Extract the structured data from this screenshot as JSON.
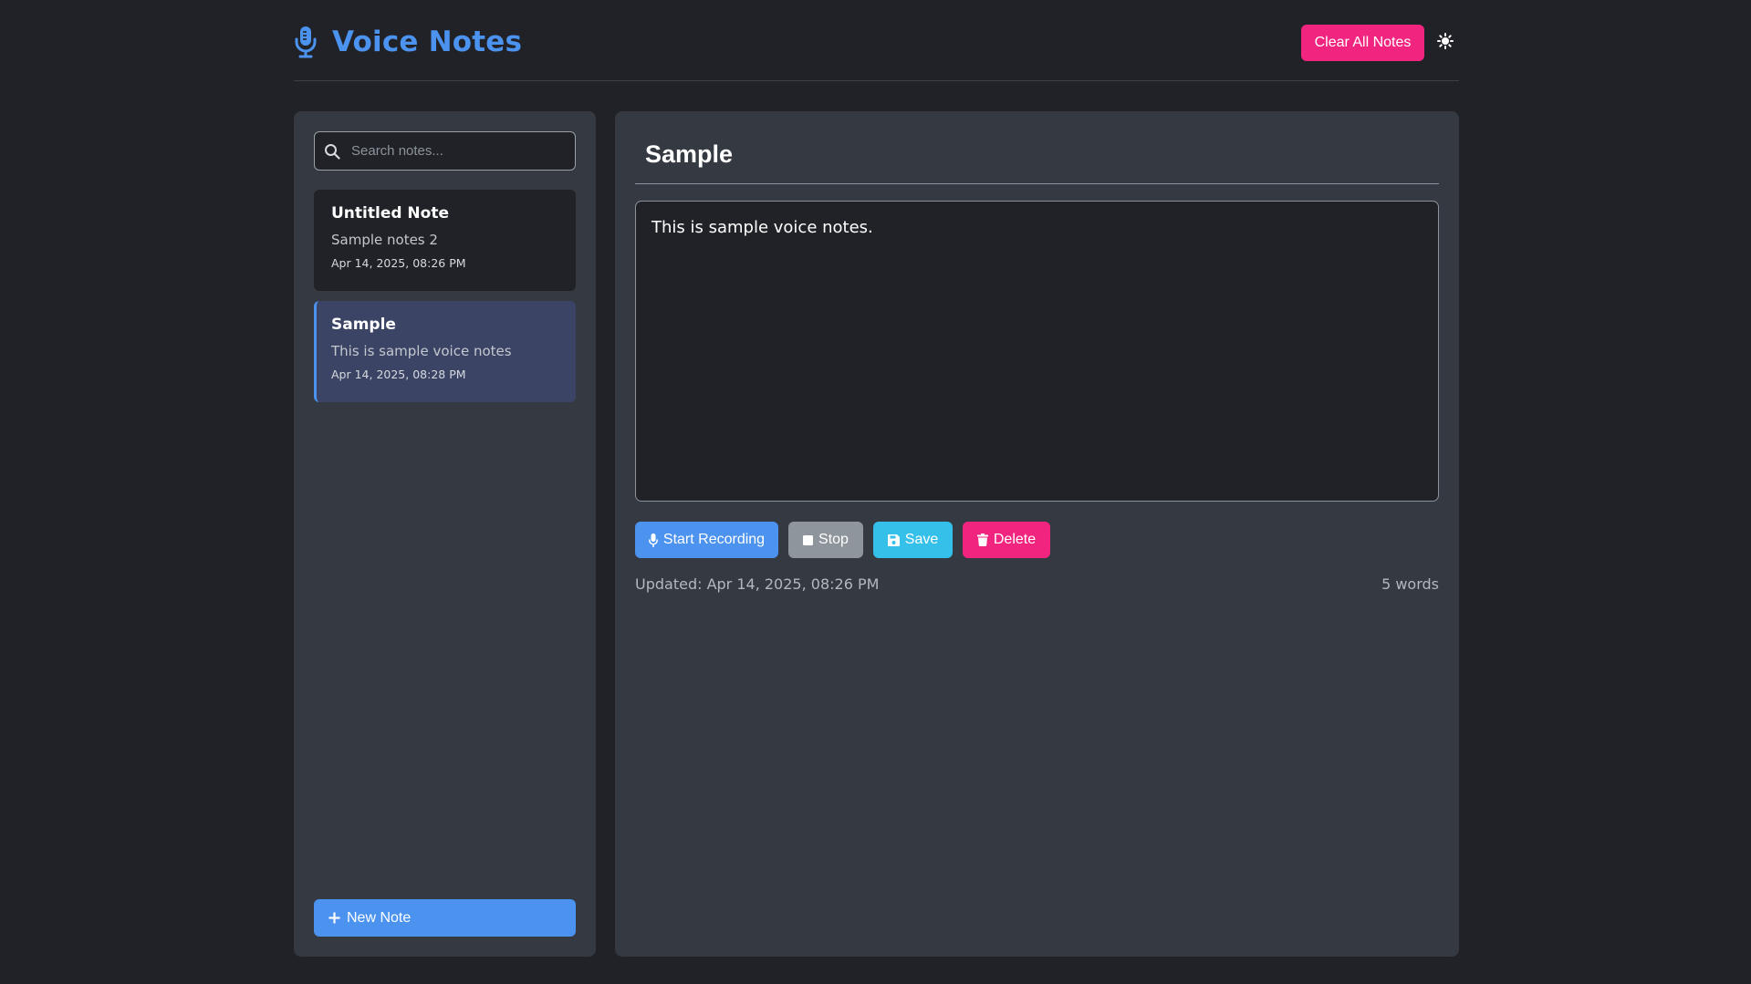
{
  "app": {
    "title": "Voice Notes",
    "clear_all_label": "Clear All Notes",
    "brand_icon": "microphone-icon",
    "theme_icon": "sun-icon"
  },
  "colors": {
    "background": "#202227",
    "panel": "#353941",
    "accent": "#4c93ef",
    "danger": "#f1247f",
    "info": "#35c0ea",
    "muted": "#8f959c",
    "active_card": "#3c4466"
  },
  "sidebar": {
    "search": {
      "placeholder": "Search notes...",
      "value": ""
    },
    "notes": [
      {
        "title": "Untitled Note",
        "preview": "Sample notes 2",
        "date": "Apr 14, 2025, 08:26 PM",
        "active": false
      },
      {
        "title": "Sample",
        "preview": "This is sample voice notes",
        "date": "Apr 14, 2025, 08:28 PM",
        "active": true
      }
    ],
    "new_note_label": "New Note"
  },
  "editor": {
    "title": "Sample",
    "body": "This is sample voice notes.",
    "buttons": {
      "start_recording": "Start Recording",
      "stop": "Stop",
      "save": "Save",
      "delete": "Delete"
    },
    "updated": "Updated: Apr 14, 2025, 08:26 PM",
    "word_count": "5 words"
  }
}
